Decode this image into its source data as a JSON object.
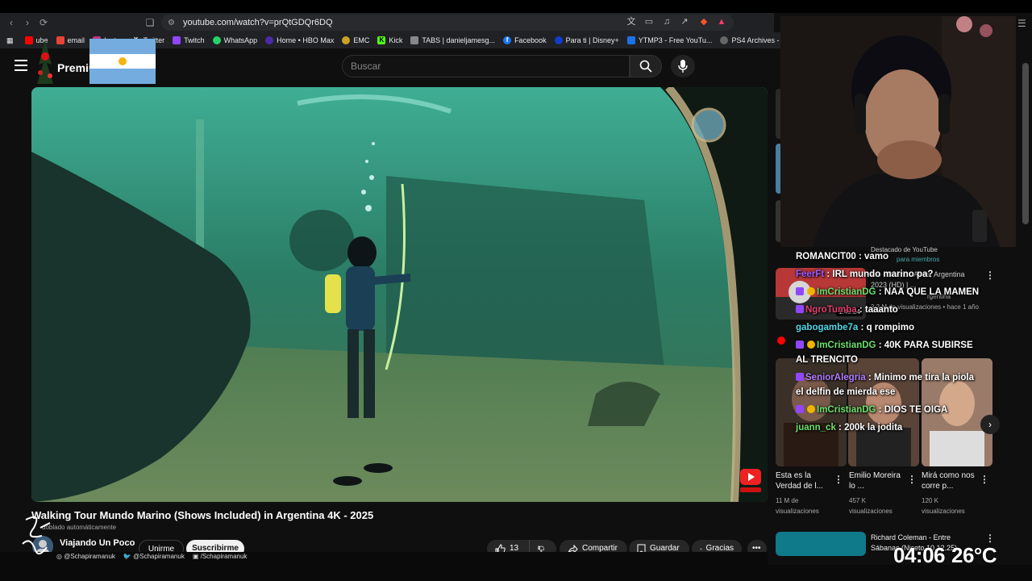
{
  "browser": {
    "url": "youtube.com/watch?v=prQtGDQr6DQ",
    "bookmarks": [
      {
        "label": "ube",
        "color": "#ff0000"
      },
      {
        "label": "email",
        "color": "#ea4335"
      },
      {
        "label": "Instag",
        "color": "#c13584"
      },
      {
        "label": "Twitter",
        "color": "#222222"
      },
      {
        "label": "Twitch",
        "color": "#9146ff"
      },
      {
        "label": "WhatsApp",
        "color": "#25d366"
      },
      {
        "label": "Home • HBO Max",
        "color": "#4b2aa8"
      },
      {
        "label": "EMC",
        "color": "#c9a227"
      },
      {
        "label": "Kick",
        "color": "#53fc18"
      },
      {
        "label": "TABS | danieljamesg...",
        "color": "#888888"
      },
      {
        "label": "Facebook",
        "color": "#1877f2"
      },
      {
        "label": "Para ti | Disney+",
        "color": "#113ccf"
      },
      {
        "label": "YTMP3 - Free YouTu...",
        "color": "#1a73e8"
      },
      {
        "label": "PS4 Archives - Dow...",
        "color": "#666666"
      }
    ]
  },
  "header": {
    "logo_label": "Premium",
    "search_placeholder": "Buscar"
  },
  "video": {
    "title": "Walking Tour Mundo Marino (Shows Included) in Argentina 4K - 2025",
    "subtitle": "doblado automáticamente",
    "channel": "Viajando Un Poco",
    "join_label": "Unirme",
    "subscribe_label": "Suscribirme",
    "like_count": "13",
    "share_label": "Compartir",
    "save_label": "Guardar",
    "thanks_label": "Gracias"
  },
  "social": {
    "instagram": "@Schapiramanuk",
    "twitter": "@Schapiramanuk",
    "facebook": "/Schapiramanuk"
  },
  "sidebar": {
    "featured_label": "Destacado de YouTube",
    "members_label": "para miembros",
    "rec_video": {
      "title": "ers - Buenos Aires, Argentina 2023 (HD) | ...",
      "channel": "rgentina",
      "meta": "3,2 M de visualizaciones • hace 1 año",
      "duration": "1:49:24"
    },
    "shorts": [
      {
        "title": "Esta es la Verdad de l...",
        "views": "11 M de",
        "views2": "visualizaciones"
      },
      {
        "title": "Emilio Moreira lo ...",
        "views": "457 K",
        "views2": "visualizaciones"
      },
      {
        "title": "Mirá como nos corre p...",
        "views": "120 K",
        "views2": "visualizaciones"
      }
    ],
    "bottom_video": {
      "title": "Richard Coleman - Entre Sábanas (Niceto 10.12.25)"
    }
  },
  "chat": [
    {
      "user": "ROMANCIT00",
      "msg": "vamo",
      "color": "#ffffff",
      "badges": []
    },
    {
      "user": "FeerFt",
      "msg": "IRL mundo marino pa?",
      "color": "#9b59ff",
      "badges": []
    },
    {
      "user": "ImCristianDG",
      "msg": "NAA QUE LA MAMEN",
      "color": "#6be06b",
      "badges": [
        "sub",
        "gold"
      ]
    },
    {
      "user": "NgroTumba",
      "msg": "taaanto",
      "color": "#e0406b",
      "badges": [
        "sub"
      ]
    },
    {
      "user": "gabogambe7a",
      "msg": "q rompimo",
      "color": "#4dd9e8",
      "badges": []
    },
    {
      "user": "ImCristianDG",
      "msg": "40K PARA SUBIRSE AL TRENCITO",
      "color": "#6be06b",
      "badges": [
        "sub",
        "gold"
      ]
    },
    {
      "user": "SeniorAlegria",
      "msg": "Minimo me tira la piola el delfin de mierda ese",
      "color": "#b07cff",
      "badges": [
        "sub"
      ]
    },
    {
      "user": "ImCristianDG",
      "msg": "DIOS TE OIGA",
      "color": "#6be06b",
      "badges": [
        "sub",
        "gold"
      ]
    },
    {
      "user": "juann_ck",
      "msg": "200k la jodita",
      "color": "#6be06b",
      "badges": []
    }
  ],
  "overlay": {
    "time": "04:06",
    "temperature": "26°C"
  }
}
